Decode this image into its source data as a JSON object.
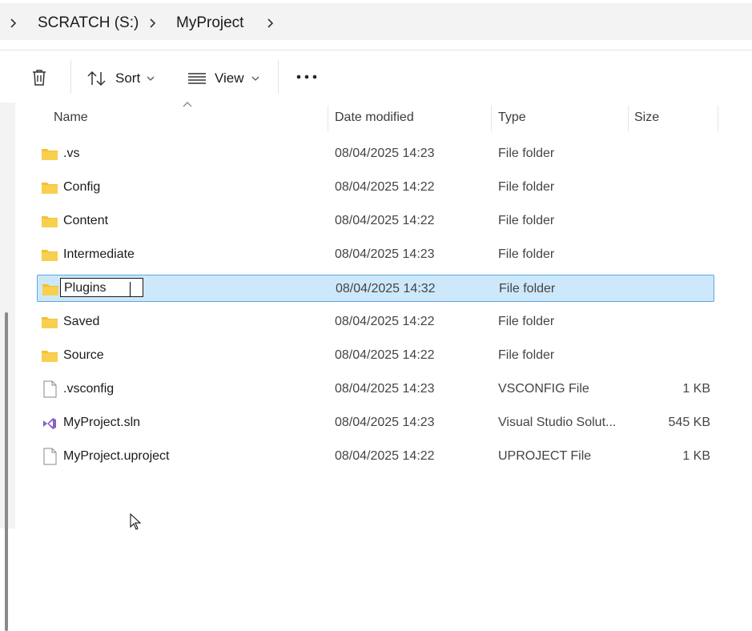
{
  "breadcrumb": {
    "items": [
      "SCRATCH (S:)",
      "MyProject"
    ]
  },
  "toolbar": {
    "sort_label": "Sort",
    "view_label": "View"
  },
  "columns": {
    "name": "Name",
    "date": "Date modified",
    "type": "Type",
    "size": "Size"
  },
  "rename": {
    "value": "Plugins"
  },
  "files": [
    {
      "name": ".vs",
      "date": "08/04/2025 14:23",
      "type": "File folder",
      "size": "",
      "icon": "folder-icon"
    },
    {
      "name": "Config",
      "date": "08/04/2025 14:22",
      "type": "File folder",
      "size": "",
      "icon": "folder-icon"
    },
    {
      "name": "Content",
      "date": "08/04/2025 14:22",
      "type": "File folder",
      "size": "",
      "icon": "folder-icon"
    },
    {
      "name": "Intermediate",
      "date": "08/04/2025 14:23",
      "type": "File folder",
      "size": "",
      "icon": "folder-icon"
    },
    {
      "name": "Plugins",
      "date": "08/04/2025 14:32",
      "type": "File folder",
      "size": "",
      "icon": "folder-icon"
    },
    {
      "name": "Saved",
      "date": "08/04/2025 14:22",
      "type": "File folder",
      "size": "",
      "icon": "folder-icon"
    },
    {
      "name": "Source",
      "date": "08/04/2025 14:22",
      "type": "File folder",
      "size": "",
      "icon": "folder-icon"
    },
    {
      "name": ".vsconfig",
      "date": "08/04/2025 14:23",
      "type": "VSCONFIG File",
      "size": "1 KB",
      "icon": "file-icon"
    },
    {
      "name": "MyProject.sln",
      "date": "08/04/2025 14:23",
      "type": "Visual Studio Solut...",
      "size": "545 KB",
      "icon": "visual-studio-icon"
    },
    {
      "name": "MyProject.uproject",
      "date": "08/04/2025 14:22",
      "type": "UPROJECT File",
      "size": "1 KB",
      "icon": "file-icon"
    }
  ],
  "colors": {
    "folder": "#f5c033",
    "selection_bg": "#cde8fb",
    "selection_border": "#5aa7e0",
    "visual_studio": "#8661c5"
  }
}
